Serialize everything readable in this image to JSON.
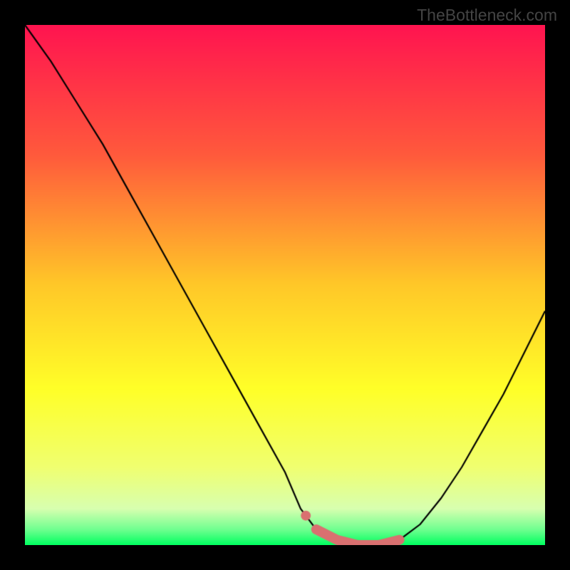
{
  "watermark": "TheBottleneck.com",
  "chart_data": {
    "type": "line",
    "title": "",
    "xlabel": "",
    "ylabel": "",
    "xlim": [
      0,
      100
    ],
    "ylim": [
      0,
      100
    ],
    "x": [
      0,
      5,
      10,
      15,
      20,
      25,
      30,
      35,
      40,
      45,
      50,
      53,
      56,
      60,
      64,
      68,
      72,
      76,
      80,
      84,
      88,
      92,
      96,
      100
    ],
    "values": [
      100,
      93,
      85,
      77,
      68,
      59,
      50,
      41,
      32,
      23,
      14,
      7,
      3,
      1,
      0,
      0,
      1,
      4,
      9,
      15,
      22,
      29,
      37,
      45
    ],
    "highlight_segment": {
      "x_start": 56,
      "x_end": 74,
      "color": "#d97070"
    },
    "gradient_stops": [
      {
        "offset": 0,
        "color": "#ff1450"
      },
      {
        "offset": 0.25,
        "color": "#ff5a3c"
      },
      {
        "offset": 0.5,
        "color": "#ffc828"
      },
      {
        "offset": 0.7,
        "color": "#ffff28"
      },
      {
        "offset": 0.85,
        "color": "#f0ff70"
      },
      {
        "offset": 0.93,
        "color": "#d8ffb0"
      },
      {
        "offset": 0.97,
        "color": "#70ff90"
      },
      {
        "offset": 1.0,
        "color": "#00ff60"
      }
    ]
  }
}
